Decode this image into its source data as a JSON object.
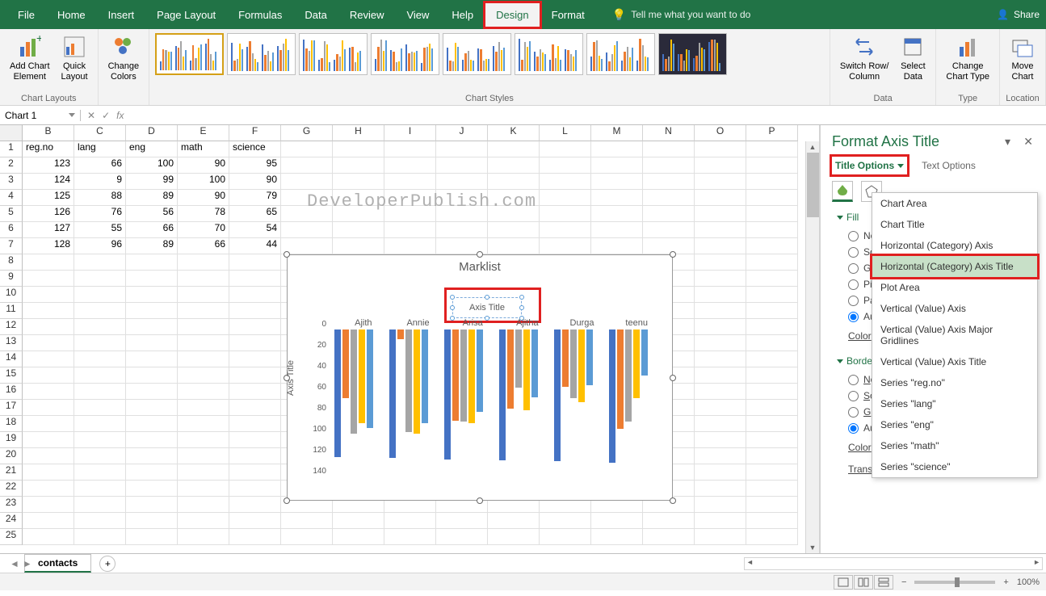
{
  "ribbon": {
    "tabs": [
      "File",
      "Home",
      "Insert",
      "Page Layout",
      "Formulas",
      "Data",
      "Review",
      "View",
      "Help",
      "Design",
      "Format"
    ],
    "active_tab": "Design",
    "highlighted_tab": "Design",
    "tell_me": "Tell me what you want to do",
    "share": "Share",
    "groups": {
      "chart_layouts": {
        "add_element": "Add Chart\nElement",
        "quick_layout": "Quick\nLayout",
        "label": "Chart Layouts"
      },
      "change_colors": {
        "label": "Change\nColors"
      },
      "chart_styles": {
        "label": "Chart Styles"
      },
      "data": {
        "switch": "Switch Row/\nColumn",
        "select": "Select\nData",
        "label": "Data"
      },
      "type": {
        "change_type": "Change\nChart Type",
        "label": "Type"
      },
      "location": {
        "move": "Move\nChart",
        "label": "Location"
      }
    }
  },
  "name_box": "Chart 1",
  "fx_label": "fx",
  "columns": [
    "B",
    "C",
    "D",
    "E",
    "F",
    "G",
    "H",
    "I",
    "J",
    "K",
    "L",
    "M",
    "N",
    "O",
    "P"
  ],
  "rows": [
    1,
    2,
    3,
    4,
    5,
    6,
    7,
    8,
    9,
    10,
    11,
    12,
    13,
    14,
    15,
    16,
    17,
    18,
    19,
    20,
    21,
    22,
    23,
    24,
    25
  ],
  "table": {
    "headers": [
      "reg.no",
      "lang",
      "eng",
      "math",
      "science"
    ],
    "data": [
      [
        123,
        66,
        100,
        90,
        95
      ],
      [
        124,
        9,
        99,
        100,
        90
      ],
      [
        125,
        88,
        89,
        90,
        79
      ],
      [
        126,
        76,
        56,
        78,
        65
      ],
      [
        127,
        55,
        66,
        70,
        54
      ],
      [
        128,
        96,
        89,
        66,
        44
      ]
    ]
  },
  "watermark": "DeveloperPublish.com",
  "chart": {
    "title": "Marklist",
    "axis_title_placeholder": "Axis Title",
    "y_axis_title": "Axis Title",
    "categories": [
      "Ajith",
      "Annie",
      "Arisa",
      "Ajitha",
      "Durga",
      "teenu"
    ]
  },
  "chart_data": {
    "type": "bar",
    "title": "Marklist",
    "xlabel": "Axis Title",
    "ylabel": "Axis Title",
    "categories": [
      "Ajith",
      "Annie",
      "Arisa",
      "Ajitha",
      "Durga",
      "teenu"
    ],
    "y_ticks": [
      0,
      20,
      40,
      60,
      80,
      100,
      120,
      140
    ],
    "ylim": [
      0,
      140
    ],
    "y_reversed": true,
    "series": [
      {
        "name": "reg.no",
        "color": "#4472C4",
        "values": [
          123,
          124,
          125,
          126,
          127,
          128
        ]
      },
      {
        "name": "lang",
        "color": "#ED7D31",
        "values": [
          66,
          9,
          88,
          76,
          55,
          96
        ]
      },
      {
        "name": "eng",
        "color": "#A5A5A5",
        "values": [
          100,
          99,
          89,
          56,
          66,
          89
        ]
      },
      {
        "name": "math",
        "color": "#FFC000",
        "values": [
          90,
          100,
          90,
          78,
          70,
          66
        ]
      },
      {
        "name": "science",
        "color": "#5B9BD5",
        "values": [
          95,
          90,
          79,
          65,
          54,
          44
        ]
      }
    ]
  },
  "format_pane": {
    "title": "Format Axis Title",
    "tabs": {
      "title_options": "Title Options",
      "text_options": "Text Options"
    },
    "sections": {
      "fill": {
        "label": "Fill",
        "options": [
          "No fill",
          "Solid fill",
          "Gradient fill",
          "Picture or texture fill",
          "Pattern fill",
          "Automatic"
        ],
        "selected": "Automatic",
        "color_label": "Color"
      },
      "border": {
        "label": "Border",
        "options": [
          "No line",
          "Solid line",
          "Gradient line",
          "Automatic"
        ],
        "selected": "Automatic",
        "color_label": "Color",
        "transparency_label": "Transparency"
      }
    },
    "dropdown_items": [
      "Chart Area",
      "Chart Title",
      "Horizontal (Category) Axis",
      "Horizontal (Category) Axis Title",
      "Plot Area",
      "Vertical (Value) Axis",
      "Vertical (Value) Axis Major Gridlines",
      "Vertical (Value) Axis Title",
      "Series \"reg.no\"",
      "Series \"lang\"",
      "Series \"eng\"",
      "Series \"math\"",
      "Series \"science\""
    ],
    "dropdown_highlighted": "Horizontal (Category) Axis Title"
  },
  "sheet": {
    "active": "contacts"
  },
  "status": {
    "zoom": "100%"
  }
}
